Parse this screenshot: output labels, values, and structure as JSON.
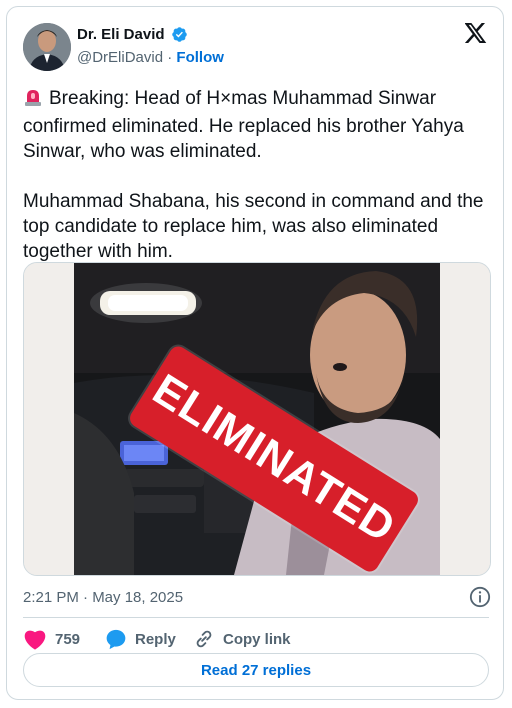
{
  "author": {
    "name": "Dr. Eli David",
    "handle": "@DrEliDavid",
    "separator": "·",
    "follow_label": "Follow"
  },
  "tweet": {
    "paragraph_1": "Breaking: Head of H×mas Muhammad Sinwar confirmed eliminated. He replaced his brother Yahya Sinwar, who was eliminated.",
    "paragraph_2": "Muhammad Shabana, his second in command and the top candidate to replace him, was also eliminated together with him.",
    "emoji_icon": "police-light-siren-icon"
  },
  "media": {
    "stamp_text": "ELIMINATED"
  },
  "meta": {
    "timestamp": "2:21 PM · May 18, 2025"
  },
  "actions": {
    "like_count": "759",
    "reply_label": "Reply",
    "copy_link_label": "Copy link"
  },
  "replies_button": {
    "label": "Read 27 replies"
  },
  "colors": {
    "accent": "#1d9bf0",
    "link": "#006fd6",
    "like": "#f91880",
    "stamp": "#d71f2a",
    "muted": "#536471"
  }
}
